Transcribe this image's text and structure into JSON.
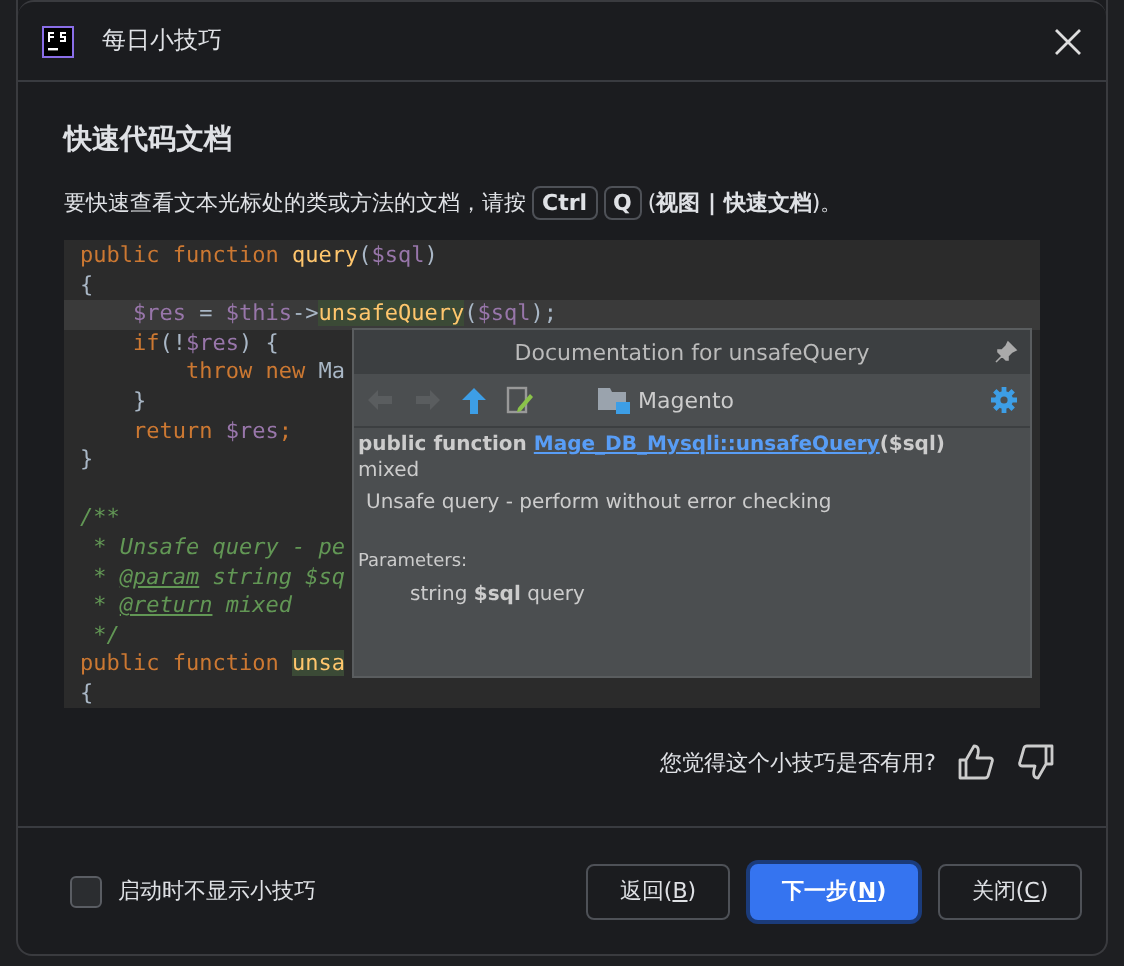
{
  "window": {
    "title": "每日小技巧"
  },
  "tip": {
    "heading": "快速代码文档",
    "text_before": "要快速查看文本光标处的类或方法的文档，请按",
    "keys": [
      "Ctrl",
      "Q"
    ],
    "text_after": "(**视图 | 快速文档**)。"
  },
  "code": {
    "lines": [
      {
        "tokens": [
          {
            "kind": "kw",
            "text": "public function "
          },
          {
            "kind": "fn",
            "text": "query"
          },
          {
            "kind": "plain",
            "text": "("
          },
          {
            "kind": "var",
            "text": "$sql"
          },
          {
            "kind": "plain",
            "text": ")"
          }
        ]
      },
      {
        "tokens": [
          {
            "kind": "plain",
            "text": "{"
          }
        ]
      },
      {
        "current": true,
        "tokens": [
          {
            "kind": "var",
            "text": "    $res"
          },
          {
            "kind": "plain",
            "text": " = "
          },
          {
            "kind": "var",
            "text": "$this"
          },
          {
            "kind": "plain",
            "text": "->"
          },
          {
            "kind": "fn",
            "text": "unsafeQuery",
            "highlight": true
          },
          {
            "kind": "plain",
            "text": "("
          },
          {
            "kind": "var",
            "text": "$sql"
          },
          {
            "kind": "plain",
            "text": ");"
          }
        ]
      },
      {
        "tokens": [
          {
            "kind": "kw",
            "text": "    if"
          },
          {
            "kind": "plain",
            "text": "(!"
          },
          {
            "kind": "var",
            "text": "$res"
          },
          {
            "kind": "plain",
            "text": ") {"
          }
        ]
      },
      {
        "tokens": [
          {
            "kind": "kw",
            "text": "        throw new "
          },
          {
            "kind": "plain",
            "text": "Ma"
          }
        ]
      },
      {
        "tokens": [
          {
            "kind": "plain",
            "text": "    }"
          }
        ]
      },
      {
        "tokens": [
          {
            "kind": "kw",
            "text": "    return "
          },
          {
            "kind": "var",
            "text": "$res"
          },
          {
            "kind": "kw",
            "text": ";"
          }
        ]
      },
      {
        "tokens": [
          {
            "kind": "plain",
            "text": "}"
          }
        ]
      },
      {
        "kind": "blank"
      },
      {
        "tokens": [
          {
            "kind": "comment",
            "text": "/**"
          }
        ]
      },
      {
        "tokens": [
          {
            "kind": "comment",
            "text": " * Unsafe query - pe"
          }
        ]
      },
      {
        "tokens": [
          {
            "kind": "comment",
            "text": " * "
          },
          {
            "kind": "doctag",
            "text": "@param"
          },
          {
            "kind": "comment",
            "text": " string $sq"
          }
        ]
      },
      {
        "tokens": [
          {
            "kind": "comment",
            "text": " * "
          },
          {
            "kind": "doctag",
            "text": "@return"
          },
          {
            "kind": "comment",
            "text": " mixed"
          }
        ]
      },
      {
        "tokens": [
          {
            "kind": "comment",
            "text": " */"
          }
        ]
      },
      {
        "tokens": [
          {
            "kind": "kw",
            "text": "public function "
          },
          {
            "kind": "fn",
            "text": "unsa",
            "highlight": true
          }
        ]
      },
      {
        "tokens": [
          {
            "kind": "plain",
            "text": "{"
          }
        ]
      }
    ]
  },
  "popup": {
    "title": "Documentation for unsafeQuery",
    "module": "Magento",
    "signature_before": "public function ",
    "signature_link": "Mage_DB_Mysqli::unsafeQuery",
    "signature_after": "($sql)",
    "return_type": "mixed",
    "description": "Unsafe query - perform without error checking",
    "params_heading": "Parameters:",
    "param": "string **$sql** query",
    "back_disabled": true,
    "forward_disabled": true
  },
  "feedback": {
    "question": "您觉得这个小技巧是否有用?"
  },
  "footer": {
    "checkbox": {
      "label": "启动时不显示小技巧",
      "checked": false
    },
    "buttons": [
      {
        "before": "返回(",
        "mnemonic": "B",
        "after": ")",
        "primary": false
      },
      {
        "before": "下一步(",
        "mnemonic": "N",
        "after": ")",
        "primary": true
      },
      {
        "before": "关闭(",
        "mnemonic": "C",
        "after": ")",
        "primary": false
      }
    ]
  }
}
